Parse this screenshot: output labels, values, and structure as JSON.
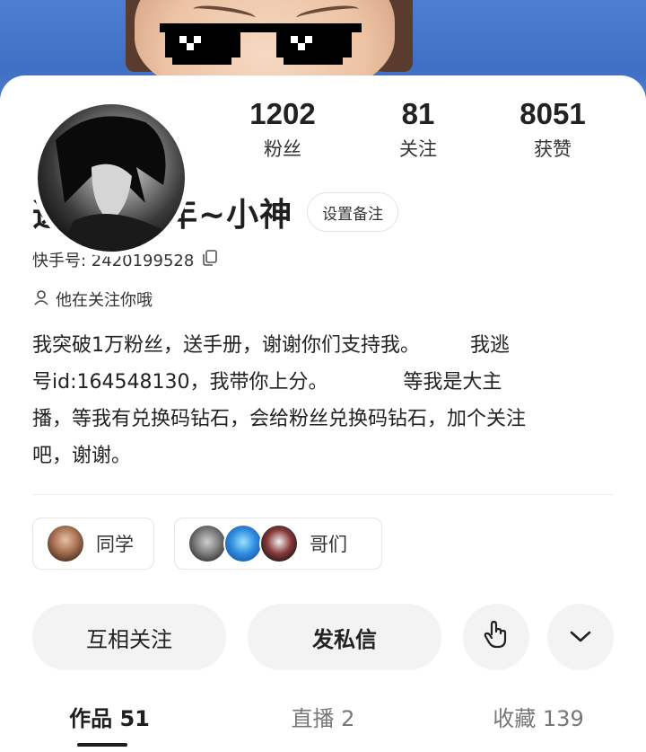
{
  "profile": {
    "stats": [
      {
        "value": "1202",
        "label": "粉丝"
      },
      {
        "value": "81",
        "label": "关注"
      },
      {
        "value": "8051",
        "label": "获赞"
      }
    ],
    "name": "逃跑吧少年~小神",
    "remark_button": "设置备注",
    "kuaishou_id": "快手号: 2420199528",
    "follows_you": "他在关注你哦",
    "bio": "我突破1万粉丝，送手册，谢谢你们支持我。        我逃\n号id:164548130，我带你上分。            等我是大主\n播，等我有兑换码钻石，会给粉丝兑换码钻石，加个关注\n吧，谢谢。"
  },
  "groups": [
    {
      "label": "同学",
      "avatar_count": 1
    },
    {
      "label": "哥们",
      "avatar_count": 3
    }
  ],
  "actions": {
    "mutual_follow": "互相关注",
    "message": "发私信",
    "gesture_icon": "hand-tap-icon",
    "more_icon": "chevron-down-icon"
  },
  "tabs": [
    {
      "label": "作品 51",
      "active": true
    },
    {
      "label": "直播 2",
      "active": false
    },
    {
      "label": "收藏 139",
      "active": false
    }
  ],
  "colors": {
    "banner": "#4d7ed0",
    "button_bg": "#f3f3f3",
    "text": "#222222"
  }
}
